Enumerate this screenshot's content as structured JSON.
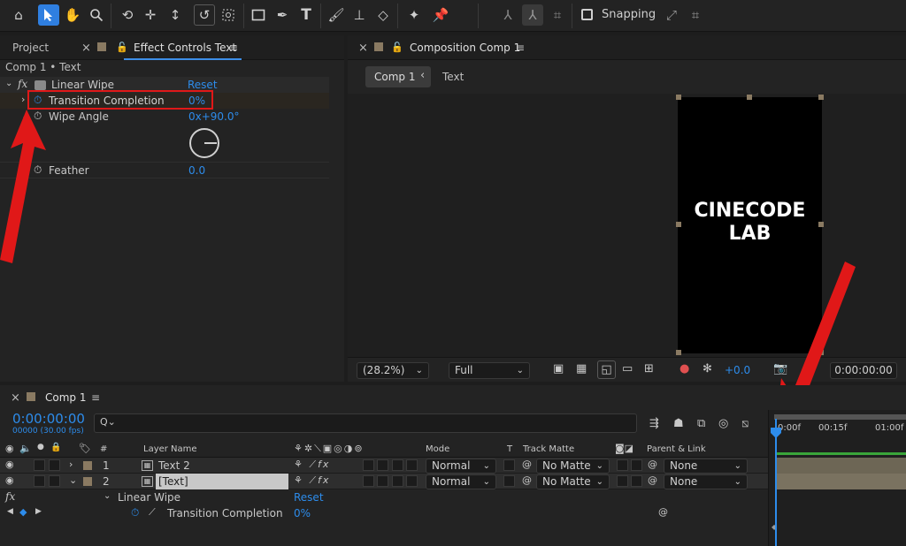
{
  "toolbar": {
    "snapping_label": "Snapping"
  },
  "project_tab": {
    "label": "Project"
  },
  "effect_controls": {
    "tab_label": "Effect Controls Text",
    "breadcrumb": "Comp 1 • Text",
    "effect_name": "Linear Wipe",
    "reset_label": "Reset",
    "fx_label": "fx",
    "props": [
      {
        "name": "Transition Completion",
        "value": "0%"
      },
      {
        "name": "Wipe Angle",
        "value": "0x+90.0°"
      },
      {
        "name": "Feather",
        "value": "0.0"
      }
    ]
  },
  "composition": {
    "tab_label": "Composition Comp 1",
    "crumb_active": "Comp 1",
    "crumb_next": "Text",
    "canvas_text_line1": "CINECODE",
    "canvas_text_line2": "LAB",
    "zoom": "(28.2%)",
    "resolution": "Full",
    "exposure": "+0.0",
    "timecode": "0:00:00:00"
  },
  "timeline": {
    "tab_label": "Comp 1",
    "timecode": "0:00:00:00",
    "frames": "00000 (30.00 fps)",
    "search_placeholder": "",
    "headers": {
      "num": "#",
      "layer_name": "Layer Name",
      "mode": "Mode",
      "t": "T",
      "track_matte": "Track Matte",
      "parent": "Parent & Link"
    },
    "ruler": [
      "0:00f",
      "00:15f",
      "01:00f"
    ],
    "layers": [
      {
        "num": "1",
        "name": "Text 2",
        "mode": "Normal",
        "matte": "No Matte",
        "parent": "None"
      },
      {
        "num": "2",
        "name": "[Text]",
        "mode": "Normal",
        "matte": "No Matte",
        "parent": "None"
      }
    ],
    "effect_name": "Linear Wipe",
    "reset_label": "Reset",
    "prop_name": "Transition Completion",
    "prop_value": "0%",
    "fx_label": "fx"
  },
  "colors": {
    "accent_blue": "#2d8ceb",
    "annotation_red": "#e01818",
    "layer_label_tan": "#8a7a62",
    "track_green": "#3aa53a"
  }
}
